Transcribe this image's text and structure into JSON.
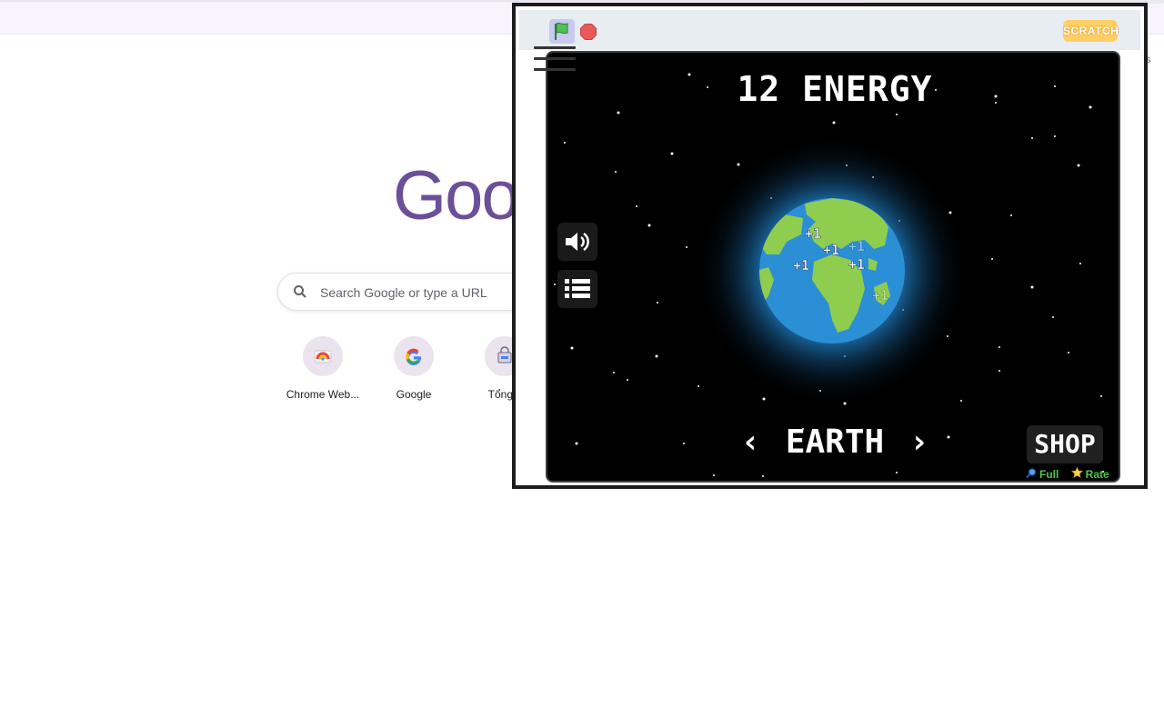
{
  "chrome": {
    "logo_text": "Goo",
    "search_placeholder": "Search Google or type a URL",
    "shortcuts": [
      {
        "label": "Chrome Web...",
        "icon": "chrome-web-store-icon"
      },
      {
        "label": "Google",
        "icon": "google-g-icon"
      },
      {
        "label": "Tổng c",
        "icon": "shopping-bag-icon"
      }
    ],
    "edge_letter": "s"
  },
  "scratch": {
    "logo_text": "SCRATCH",
    "flag_icon": "green-flag-icon",
    "stop_icon": "stop-sign-icon",
    "menu_icon": "hamburger-menu-icon"
  },
  "game": {
    "energy_text": "12 ENERGY",
    "planet_name": "EARTH",
    "prev_arrow": "‹",
    "next_arrow": "›",
    "shop_label": "SHOP",
    "sound_icon": "speaker-icon",
    "list_icon": "list-icon",
    "plus_labels": [
      "+1",
      "+1",
      "+1",
      "+1",
      "+1",
      "+1"
    ],
    "footer": {
      "full_label": "Full",
      "rate_label": "Rate"
    },
    "colors": {
      "ocean": "#2b8fd6",
      "land": "#8fcd4f",
      "glow": "#1a5a8a",
      "footer_green": "#47c84a"
    }
  }
}
